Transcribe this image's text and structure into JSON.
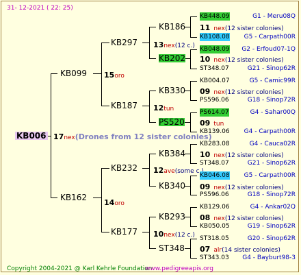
{
  "header": {
    "date": "31- 12-2021 ( 22: 25)"
  },
  "footer": {
    "copyright": "Copyright 2004-2021 @ Karl Kehrle Foundation",
    "site": "www.pedigreeapis.org"
  },
  "root": {
    "id": "KB006",
    "num": "17",
    "place": "nex",
    "note": "(Drones from 12 sister colonies)"
  },
  "gen1": [
    {
      "id": "KB099",
      "num": "15",
      "place": "oro"
    },
    {
      "id": "KB162",
      "num": "14",
      "place": "oro"
    }
  ],
  "gen2": [
    {
      "id": "KB297",
      "num": "13",
      "place": "nex",
      "note": "(12 c.)"
    },
    {
      "id": "KB187",
      "num": "12",
      "place": "tun",
      "note": ""
    },
    {
      "id": "KB232",
      "num": "12",
      "place": "ave",
      "note": "(some c.)"
    },
    {
      "id": "KB177",
      "num": "10",
      "place": "nex",
      "note": "(12 c.)"
    }
  ],
  "gen3": [
    {
      "id": "KB186",
      "num": "11",
      "place": "nex",
      "note": "(12 sister colonies)"
    },
    {
      "id": "KB202",
      "num": "10",
      "place": "nex",
      "note": "(12 sister colonies)"
    },
    {
      "id": "KB330",
      "num": "09",
      "place": "nex",
      "note": "(12 sister colonies)"
    },
    {
      "id": "PS520",
      "num": "09",
      "place": "tun",
      "note": ""
    },
    {
      "id": "KB384",
      "num": "10",
      "place": "nex",
      "note": "(12 sister colonies)"
    },
    {
      "id": "KB340",
      "num": "09",
      "place": "nex",
      "note": "(12 sister colonies)"
    },
    {
      "id": "KB293",
      "num": "08",
      "place": "nex",
      "note": "(12 sister colonies)"
    },
    {
      "id": "ST348",
      "num": "07",
      "place": "alr",
      "note": "(14 sister colonies)"
    }
  ],
  "gen4": [
    {
      "id": "KB448.09",
      "loc": "G1 - Meru08Q"
    },
    {
      "id": "KB108.08",
      "loc": "G5 - Carpath00R"
    },
    {
      "id": "KB048.09",
      "loc": "G2 - Erfoud07-1Q"
    },
    {
      "id": "ST348.07",
      "loc": "G21 - Sinop62R"
    },
    {
      "id": "KB004.07",
      "loc": "G5 - Camic99R"
    },
    {
      "id": "PS596.06",
      "loc": "G18 - Sinop72R"
    },
    {
      "id": "PS614.07",
      "loc": "G4 - Sahar00Q"
    },
    {
      "id": "KB139.06",
      "loc": "G4 - Carpath00R"
    },
    {
      "id": "KB283.08",
      "loc": "G4 - Cauca02R"
    },
    {
      "id": "ST348.07",
      "loc": "G21 - Sinop62R"
    },
    {
      "id": "KB046.08",
      "loc": "G5 - Carpath00R"
    },
    {
      "id": "PS596.06",
      "loc": "G18 - Sinop72R"
    },
    {
      "id": "KB129.06",
      "loc": "G4 - Ankar02Q"
    },
    {
      "id": "KB050.05",
      "loc": "G19 - Sinop62R"
    },
    {
      "id": "ST318.05",
      "loc": "G20 - Sinop62R"
    },
    {
      "id": "ST343.03",
      "loc": "G4 - Bayburt98-3"
    }
  ]
}
